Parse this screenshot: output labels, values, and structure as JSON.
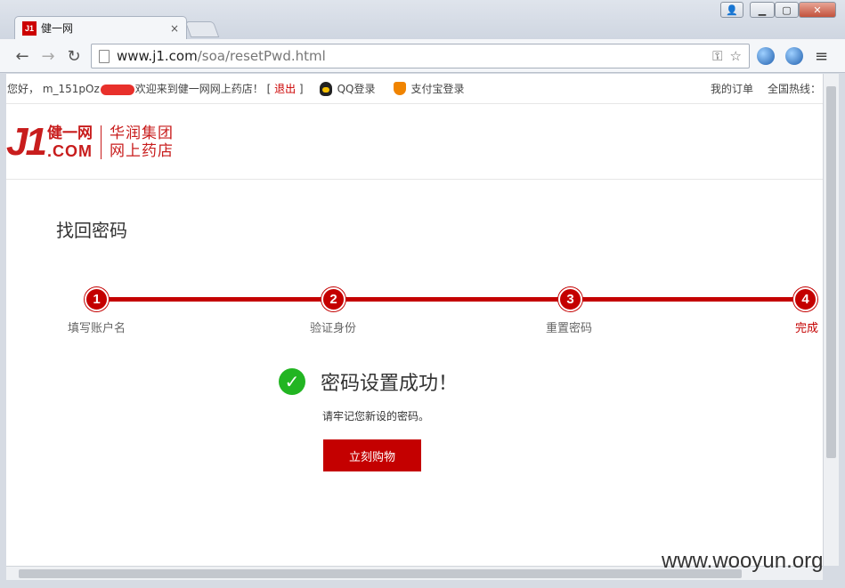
{
  "browser": {
    "tab_title": "健一网",
    "tab_favicon": "J1",
    "tab_close": "×",
    "url_host": "www.j1.com",
    "url_path": "/soa/resetPwd.html"
  },
  "topbar": {
    "greeting": "您好， m_151pOz",
    "welcome": "欢迎来到健一网网上药店！ [ ",
    "logout": "退出",
    "bracket_close": " ]",
    "qq_login": "QQ登录",
    "alipay_login": "支付宝登录",
    "my_orders": "我的订单",
    "hotline": "全国热线："
  },
  "logo": {
    "j1": "J1",
    "cn": "健一网",
    "com": ".COM",
    "sub1": "华润集团",
    "sub2": "网上药店"
  },
  "page": {
    "title": "找回密码",
    "steps": [
      {
        "num": "1",
        "label": "填写账户名"
      },
      {
        "num": "2",
        "label": "验证身份"
      },
      {
        "num": "3",
        "label": "重置密码"
      },
      {
        "num": "4",
        "label": "完成"
      }
    ],
    "success_message": "密码设置成功！",
    "remember_note": "请牢记您新设的密码。",
    "shop_button": "立刻购物"
  },
  "watermark": "www.wooyun.org",
  "colors": {
    "brand_red": "#c40000",
    "success_green": "#22b522"
  }
}
